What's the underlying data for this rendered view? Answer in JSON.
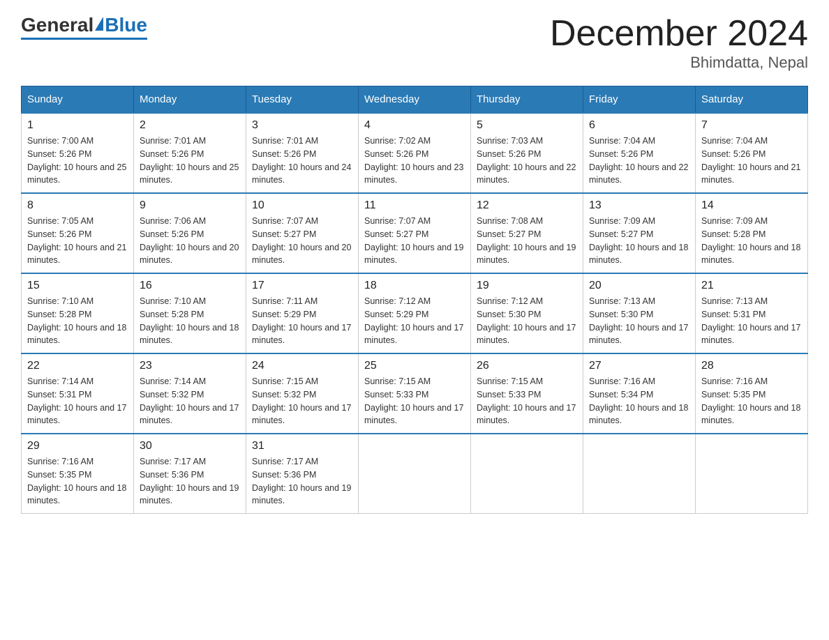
{
  "header": {
    "logo": {
      "general": "General",
      "blue": "Blue"
    },
    "title": "December 2024",
    "location": "Bhimdatta, Nepal"
  },
  "weekdays": [
    "Sunday",
    "Monday",
    "Tuesday",
    "Wednesday",
    "Thursday",
    "Friday",
    "Saturday"
  ],
  "weeks": [
    [
      {
        "day": "1",
        "sunrise": "7:00 AM",
        "sunset": "5:26 PM",
        "daylight": "10 hours and 25 minutes."
      },
      {
        "day": "2",
        "sunrise": "7:01 AM",
        "sunset": "5:26 PM",
        "daylight": "10 hours and 25 minutes."
      },
      {
        "day": "3",
        "sunrise": "7:01 AM",
        "sunset": "5:26 PM",
        "daylight": "10 hours and 24 minutes."
      },
      {
        "day": "4",
        "sunrise": "7:02 AM",
        "sunset": "5:26 PM",
        "daylight": "10 hours and 23 minutes."
      },
      {
        "day": "5",
        "sunrise": "7:03 AM",
        "sunset": "5:26 PM",
        "daylight": "10 hours and 22 minutes."
      },
      {
        "day": "6",
        "sunrise": "7:04 AM",
        "sunset": "5:26 PM",
        "daylight": "10 hours and 22 minutes."
      },
      {
        "day": "7",
        "sunrise": "7:04 AM",
        "sunset": "5:26 PM",
        "daylight": "10 hours and 21 minutes."
      }
    ],
    [
      {
        "day": "8",
        "sunrise": "7:05 AM",
        "sunset": "5:26 PM",
        "daylight": "10 hours and 21 minutes."
      },
      {
        "day": "9",
        "sunrise": "7:06 AM",
        "sunset": "5:26 PM",
        "daylight": "10 hours and 20 minutes."
      },
      {
        "day": "10",
        "sunrise": "7:07 AM",
        "sunset": "5:27 PM",
        "daylight": "10 hours and 20 minutes."
      },
      {
        "day": "11",
        "sunrise": "7:07 AM",
        "sunset": "5:27 PM",
        "daylight": "10 hours and 19 minutes."
      },
      {
        "day": "12",
        "sunrise": "7:08 AM",
        "sunset": "5:27 PM",
        "daylight": "10 hours and 19 minutes."
      },
      {
        "day": "13",
        "sunrise": "7:09 AM",
        "sunset": "5:27 PM",
        "daylight": "10 hours and 18 minutes."
      },
      {
        "day": "14",
        "sunrise": "7:09 AM",
        "sunset": "5:28 PM",
        "daylight": "10 hours and 18 minutes."
      }
    ],
    [
      {
        "day": "15",
        "sunrise": "7:10 AM",
        "sunset": "5:28 PM",
        "daylight": "10 hours and 18 minutes."
      },
      {
        "day": "16",
        "sunrise": "7:10 AM",
        "sunset": "5:28 PM",
        "daylight": "10 hours and 18 minutes."
      },
      {
        "day": "17",
        "sunrise": "7:11 AM",
        "sunset": "5:29 PM",
        "daylight": "10 hours and 17 minutes."
      },
      {
        "day": "18",
        "sunrise": "7:12 AM",
        "sunset": "5:29 PM",
        "daylight": "10 hours and 17 minutes."
      },
      {
        "day": "19",
        "sunrise": "7:12 AM",
        "sunset": "5:30 PM",
        "daylight": "10 hours and 17 minutes."
      },
      {
        "day": "20",
        "sunrise": "7:13 AM",
        "sunset": "5:30 PM",
        "daylight": "10 hours and 17 minutes."
      },
      {
        "day": "21",
        "sunrise": "7:13 AM",
        "sunset": "5:31 PM",
        "daylight": "10 hours and 17 minutes."
      }
    ],
    [
      {
        "day": "22",
        "sunrise": "7:14 AM",
        "sunset": "5:31 PM",
        "daylight": "10 hours and 17 minutes."
      },
      {
        "day": "23",
        "sunrise": "7:14 AM",
        "sunset": "5:32 PM",
        "daylight": "10 hours and 17 minutes."
      },
      {
        "day": "24",
        "sunrise": "7:15 AM",
        "sunset": "5:32 PM",
        "daylight": "10 hours and 17 minutes."
      },
      {
        "day": "25",
        "sunrise": "7:15 AM",
        "sunset": "5:33 PM",
        "daylight": "10 hours and 17 minutes."
      },
      {
        "day": "26",
        "sunrise": "7:15 AM",
        "sunset": "5:33 PM",
        "daylight": "10 hours and 17 minutes."
      },
      {
        "day": "27",
        "sunrise": "7:16 AM",
        "sunset": "5:34 PM",
        "daylight": "10 hours and 18 minutes."
      },
      {
        "day": "28",
        "sunrise": "7:16 AM",
        "sunset": "5:35 PM",
        "daylight": "10 hours and 18 minutes."
      }
    ],
    [
      {
        "day": "29",
        "sunrise": "7:16 AM",
        "sunset": "5:35 PM",
        "daylight": "10 hours and 18 minutes."
      },
      {
        "day": "30",
        "sunrise": "7:17 AM",
        "sunset": "5:36 PM",
        "daylight": "10 hours and 19 minutes."
      },
      {
        "day": "31",
        "sunrise": "7:17 AM",
        "sunset": "5:36 PM",
        "daylight": "10 hours and 19 minutes."
      },
      null,
      null,
      null,
      null
    ]
  ]
}
